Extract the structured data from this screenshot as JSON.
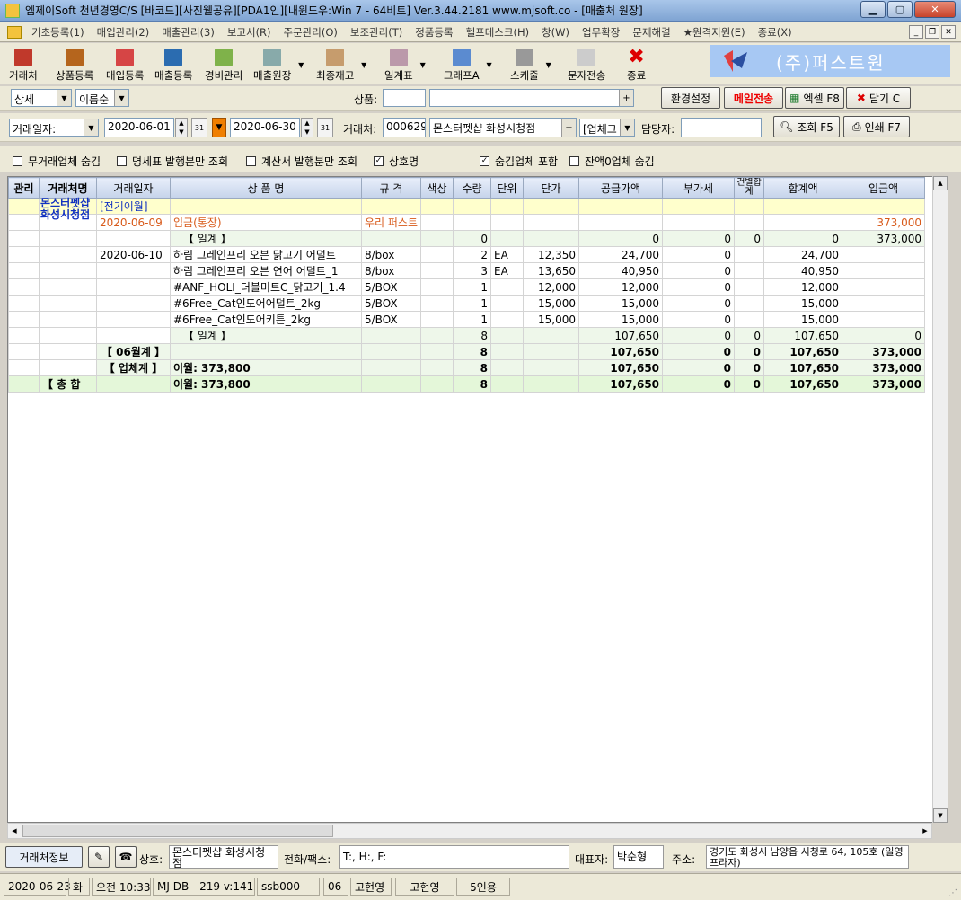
{
  "window": {
    "title": "엠제이Soft 천년경영C/S [바코드][사진웰공유][PDA1인][내윈도우:Win 7 - 64비트] Ver.3.44.2181                 www.mjsoft.co - [매출처 원장]"
  },
  "menu": [
    "기초등록(1)",
    "매입관리(2)",
    "매출관리(3)",
    "보고서(R)",
    "주문관리(O)",
    "보조관리(T)",
    "정품등록",
    "헬프데스크(H)",
    "창(W)",
    "업무확장",
    "문제해결",
    "★원격지원(E)",
    "종료(X)"
  ],
  "toolbar": {
    "items": [
      "거래처",
      "상품등록",
      "매입등록",
      "매출등록",
      "경비관리",
      "매출원장",
      "최종재고",
      "일계표",
      "그래프A",
      "스케줄",
      "문자전송",
      "종료"
    ],
    "logo_text": "(주)퍼스트원"
  },
  "filter1": {
    "view_select": "상세",
    "sort_select": "이름순",
    "product_label": "상품:",
    "settings_btn": "환경설정",
    "email_btn": "메일전송",
    "excel_btn": "엑셀 F8",
    "close_btn": "닫기 C"
  },
  "filter2": {
    "date_type": "거래일자:",
    "date_from": "2020-06-01",
    "date_to": "2020-06-30",
    "client_label": "거래처:",
    "client_code": "000629",
    "client_name": "몬스터펫샵 화성시청점",
    "client_type": "[업체그",
    "manager_label": "담당자:",
    "search_btn": "조회 F5",
    "print_btn": "인쇄 F7"
  },
  "checks": [
    {
      "label": "무거래업체 숨김",
      "checked": false
    },
    {
      "label": "명세표 발행분만 조회",
      "checked": false
    },
    {
      "label": "계산서 발행분만 조회",
      "checked": false
    },
    {
      "label": "상호명",
      "checked": true
    },
    {
      "label": "숨김업체 포함",
      "checked": true
    },
    {
      "label": "잔액0업체 숨김",
      "checked": false
    }
  ],
  "grid": {
    "headers": [
      "관리",
      "거래처명",
      "거래일자",
      "상 품 명",
      "규 격",
      "색상",
      "수량",
      "단위",
      "단가",
      "공급가액",
      "부가세",
      "건별합계",
      "합계액",
      "입금액"
    ],
    "client_name": "몬스터펫샵 화성시청점",
    "rows": [
      {
        "cls": "y",
        "cells": [
          "",
          "",
          "[전기이월]",
          "",
          "",
          "",
          "",
          "",
          "",
          "",
          "",
          "",
          "",
          ""
        ]
      },
      {
        "cls": "w",
        "red": true,
        "cells": [
          "",
          "",
          "2020-06-09",
          "입금(통장)",
          "우리 퍼스트",
          "",
          "",
          "",
          "",
          "",
          "",
          "",
          "",
          "373,000"
        ]
      },
      {
        "cls": "lg",
        "cells": [
          "",
          "",
          "",
          "【 일계 】",
          "",
          "",
          "0",
          "",
          "",
          "0",
          "0",
          "0",
          "0",
          "373,000"
        ]
      },
      {
        "cls": "w",
        "cells": [
          "",
          "",
          "2020-06-10",
          "하림 그레인프리 오븐 닭고기 어덜트",
          "8/box",
          "",
          "2",
          "EA",
          "12,350",
          "24,700",
          "0",
          "",
          "24,700",
          ""
        ]
      },
      {
        "cls": "w",
        "cells": [
          "",
          "",
          "",
          "하림 그레인프리 오븐 연어 어덜트_1",
          "8/box",
          "",
          "3",
          "EA",
          "13,650",
          "40,950",
          "0",
          "",
          "40,950",
          ""
        ]
      },
      {
        "cls": "w",
        "cells": [
          "",
          "",
          "",
          "#ANF_HOLI_더블미트C_닭고기_1.4",
          "5/BOX",
          "",
          "1",
          "",
          "12,000",
          "12,000",
          "0",
          "",
          "12,000",
          ""
        ]
      },
      {
        "cls": "w",
        "cells": [
          "",
          "",
          "",
          "#6Free_Cat인도어어덜트_2kg",
          "5/BOX",
          "",
          "1",
          "",
          "15,000",
          "15,000",
          "0",
          "",
          "15,000",
          ""
        ]
      },
      {
        "cls": "w",
        "cells": [
          "",
          "",
          "",
          "#6Free_Cat인도어키튼_2kg",
          "5/BOX",
          "",
          "1",
          "",
          "15,000",
          "15,000",
          "0",
          "",
          "15,000",
          ""
        ]
      },
      {
        "cls": "lg",
        "cells": [
          "",
          "",
          "",
          "【 일계 】",
          "",
          "",
          "8",
          "",
          "",
          "107,650",
          "0",
          "0",
          "107,650",
          "0"
        ]
      },
      {
        "cls": "lg",
        "bold": true,
        "cells": [
          "",
          "",
          "【 06월계 】",
          "",
          "",
          "",
          "8",
          "",
          "",
          "107,650",
          "0",
          "0",
          "107,650",
          "373,000"
        ]
      },
      {
        "cls": "lg",
        "bold": true,
        "cells": [
          "",
          "",
          "【 업체계 】",
          "이월: 373,800",
          "",
          "",
          "8",
          "",
          "",
          "107,650",
          "0",
          "0",
          "107,650",
          "373,000"
        ]
      },
      {
        "cls": "g",
        "bold": true,
        "total": true,
        "cells": [
          "",
          "【 총 합",
          "",
          "이월: 373,800",
          "",
          "",
          "8",
          "",
          "",
          "107,650",
          "0",
          "0",
          "107,650",
          "373,000"
        ]
      }
    ]
  },
  "info": {
    "tab_label": "거래처정보",
    "company_label": "상호:",
    "company": "몬스터펫샵 화성시청점",
    "phone_label": "전화/팩스:",
    "phone": "T:, H:, F:",
    "ceo_label": "대표자:",
    "ceo": "박순형",
    "addr_label": "주소:",
    "addr": "경기도 화성시 남양읍 시청로 64, 105호 (일영프라자)"
  },
  "status": [
    "2020-06-23",
    "화",
    "오전 10:33",
    "MJ DB - 219 v:141",
    "ssb000",
    "06",
    "고현영",
    "고현영",
    "5인용"
  ],
  "colors": {
    "accent": "#1030c0",
    "red": "#d85a1a",
    "yellow_row": "#ffffcc",
    "green_row": "#e4f7d9",
    "logo_bg": "#a7c8f3"
  }
}
